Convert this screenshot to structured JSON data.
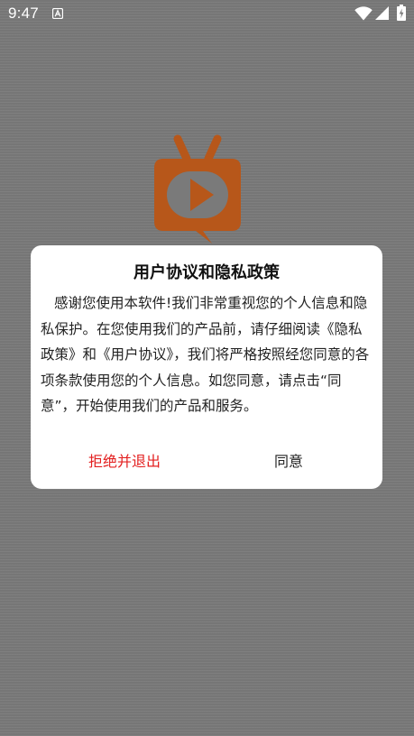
{
  "status_bar": {
    "time": "9:47",
    "icons": [
      "notification-a-icon",
      "wifi-icon",
      "signal-icon",
      "battery-icon"
    ]
  },
  "splash": {
    "logo_icon": "tv-play-logo-icon",
    "logo_color": "#b7571a"
  },
  "dialog": {
    "title": "用户协议和隐私政策",
    "body": "感谢您使用本软件!我们非常重视您的个人信息和隐私保护。在您使用我们的产品前，请仔细阅读《隐私政策》和《用户协议》，我们将严格按照经您同意的各项条款使用您的个人信息。如您同意，请点击“同意”，开始使用我们的产品和服务。",
    "reject_label": "拒绝并退出",
    "agree_label": "同意",
    "reject_color": "#e32020"
  }
}
